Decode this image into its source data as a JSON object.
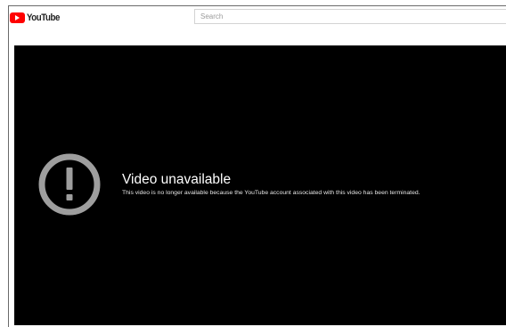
{
  "header": {
    "logo_text": "YouTube",
    "search_placeholder": "Search"
  },
  "player": {
    "error_title": "Video unavailable",
    "error_reason": "This video is no longer available because the YouTube account associated with this video has been terminated.",
    "icon": "alert-circle-icon"
  },
  "colors": {
    "brand_red": "#ff0000",
    "player_background": "#000000",
    "alert_icon": "#9e9e9e"
  }
}
